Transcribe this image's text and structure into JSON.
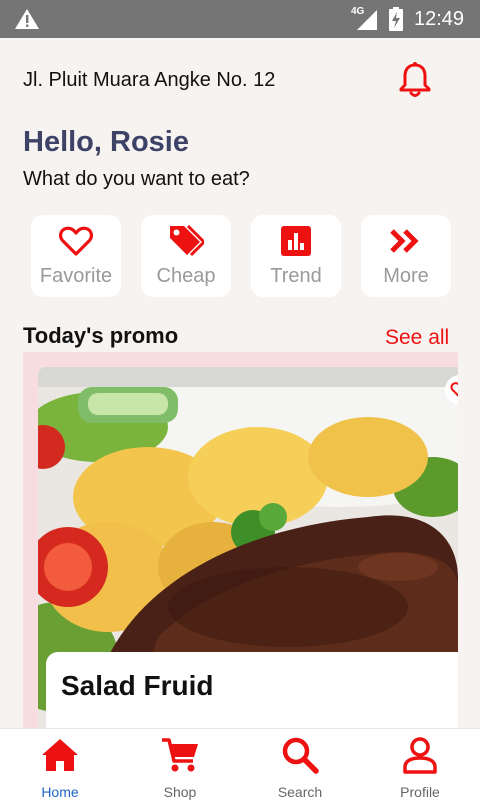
{
  "status_bar": {
    "network": "4G",
    "time": "12:49"
  },
  "header": {
    "address": "Jl. Pluit Muara Angke No. 12",
    "notification_icon": "bell-icon"
  },
  "greeting": {
    "title": "Hello, Rosie",
    "subtitle": "What do you want to eat?"
  },
  "categories": [
    {
      "label": "Favorite",
      "icon": "heart-icon"
    },
    {
      "label": "Cheap",
      "icon": "tags-icon"
    },
    {
      "label": "Trend",
      "icon": "chart-icon"
    },
    {
      "label": "More",
      "icon": "double-chevron-icon"
    }
  ],
  "promo": {
    "title": "Today's promo",
    "see_all": "See all",
    "item_name": "Salad Fruid"
  },
  "bottom_nav": [
    {
      "label": "Home",
      "icon": "home-icon",
      "active": true
    },
    {
      "label": "Shop",
      "icon": "cart-icon",
      "active": false
    },
    {
      "label": "Search",
      "icon": "search-icon",
      "active": false
    },
    {
      "label": "Profile",
      "icon": "user-icon",
      "active": false
    }
  ],
  "colors": {
    "accent": "#ee1111",
    "greeting": "#3d4266",
    "active_nav": "#1e63c9",
    "promo_bg": "#f7dde0"
  }
}
